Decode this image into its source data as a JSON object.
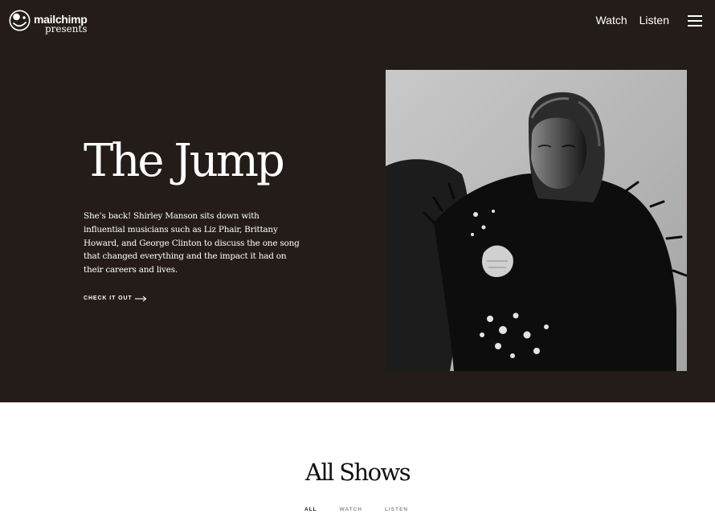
{
  "brand": {
    "name": "mailchimp",
    "tagline": "presents"
  },
  "nav": {
    "items": [
      {
        "label": "Watch"
      },
      {
        "label": "Listen"
      }
    ],
    "menu_icon": "hamburger-menu-icon"
  },
  "hero": {
    "title": "The Jump",
    "description": "She’s back! Shirley Manson sits down with influential musicians such as Liz Phair, Brittany Howard, and George Clinton to discuss the one song that changed everything and the impact it had on their careers and lives.",
    "cta_label": "CHECK IT OUT",
    "cta_icon": "arrow-right-icon"
  },
  "shows": {
    "title": "All Shows",
    "filters": [
      {
        "label": "ALL",
        "active": true
      },
      {
        "label": "WATCH",
        "active": false
      },
      {
        "label": "LISTEN",
        "active": false
      }
    ]
  },
  "colors": {
    "hero_background": "#231c18",
    "text_on_dark": "#ffffff",
    "page_background": "#ffffff",
    "active_filter": "#1a1a1a",
    "inactive_filter": "#909090"
  }
}
